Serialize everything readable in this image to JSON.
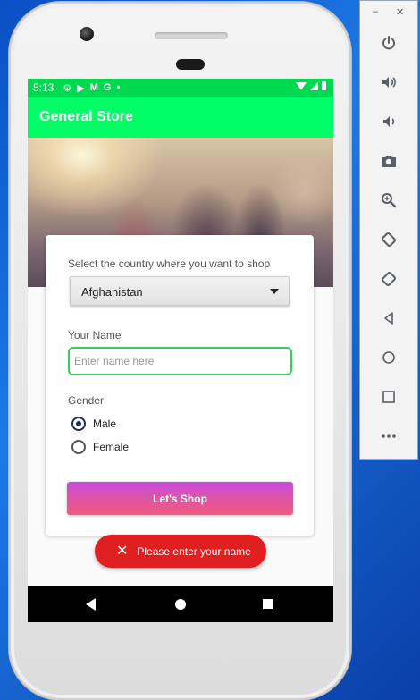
{
  "status_bar": {
    "time": "5:13",
    "icons": [
      "gear-icon",
      "play-icon",
      "gmail-icon",
      "google-icon",
      "dot-icon"
    ]
  },
  "app": {
    "title": "General Store",
    "country_label": "Select the country where you want to shop",
    "country_selected": "Afghanistan",
    "name_label": "Your Name",
    "name_placeholder": "Enter name here",
    "name_value": "",
    "gender_label": "Gender",
    "gender_options": [
      {
        "label": "Male",
        "checked": true
      },
      {
        "label": "Female",
        "checked": false
      }
    ],
    "shop_button": "Let's  Shop"
  },
  "toast": {
    "icon": "close-icon",
    "message": "Please enter your name"
  },
  "emulator_panel": {
    "window_controls": [
      "minimize",
      "close"
    ],
    "tools": [
      "power-icon",
      "volume-up-icon",
      "volume-down-icon",
      "camera-icon",
      "zoom-icon",
      "rotate-left-icon",
      "rotate-right-icon",
      "back-icon",
      "home-icon",
      "overview-icon",
      "more-icon"
    ]
  },
  "colors": {
    "status_bar": "#00d94f",
    "app_bar": "#00ff66",
    "input_border": "#34d15a",
    "button_gradient_start": "#c94be0",
    "button_gradient_end": "#ef5a7e",
    "toast": "#e02020"
  }
}
